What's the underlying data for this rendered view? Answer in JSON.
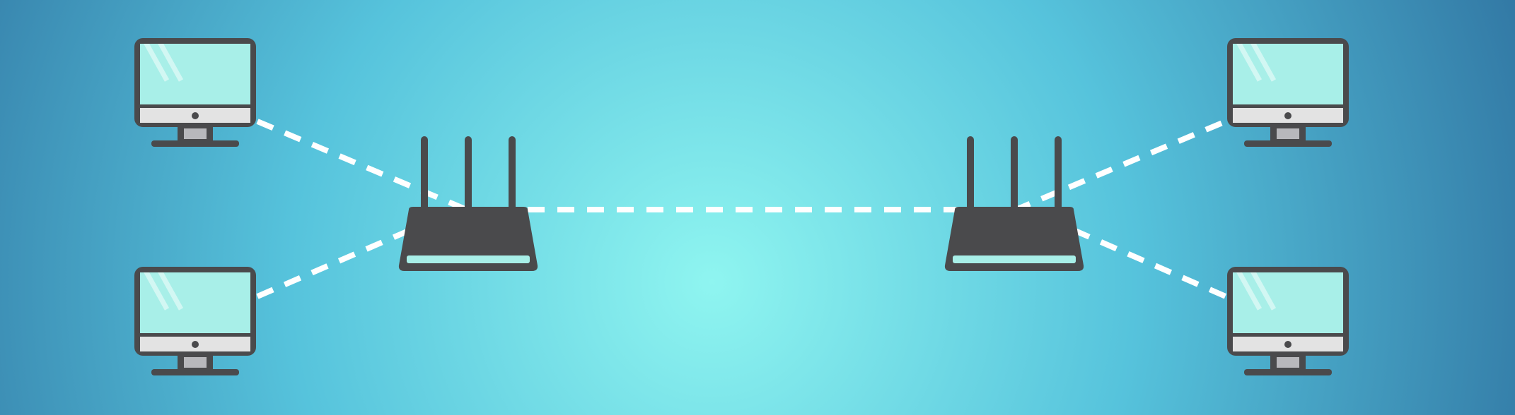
{
  "colors": {
    "background_center": "#8ff5f0",
    "background_mid": "#56c3dc",
    "background_edge": "#2b6a9a",
    "device_dark": "#4a4a4c",
    "screen": "#a8efe8",
    "screen_glare": "#d2f7f3",
    "bezel": "#e3e3e3",
    "stand": "#b8b8bc",
    "router_light": "#a8efe8",
    "link": "#ffffff"
  },
  "nodes": [
    {
      "id": "computer-top-left",
      "type": "computer",
      "icon": "monitor-icon"
    },
    {
      "id": "computer-bottom-left",
      "type": "computer",
      "icon": "monitor-icon"
    },
    {
      "id": "router-left",
      "type": "router",
      "icon": "router-icon"
    },
    {
      "id": "router-right",
      "type": "router",
      "icon": "router-icon"
    },
    {
      "id": "computer-top-right",
      "type": "computer",
      "icon": "monitor-icon"
    },
    {
      "id": "computer-bottom-right",
      "type": "computer",
      "icon": "monitor-icon"
    }
  ],
  "links": [
    {
      "from": "computer-top-left",
      "to": "router-left",
      "style": "dashed"
    },
    {
      "from": "computer-bottom-left",
      "to": "router-left",
      "style": "dashed"
    },
    {
      "from": "router-left",
      "to": "router-right",
      "style": "dashed"
    },
    {
      "from": "router-right",
      "to": "computer-top-right",
      "style": "dashed"
    },
    {
      "from": "router-right",
      "to": "computer-bottom-right",
      "style": "dashed"
    }
  ]
}
